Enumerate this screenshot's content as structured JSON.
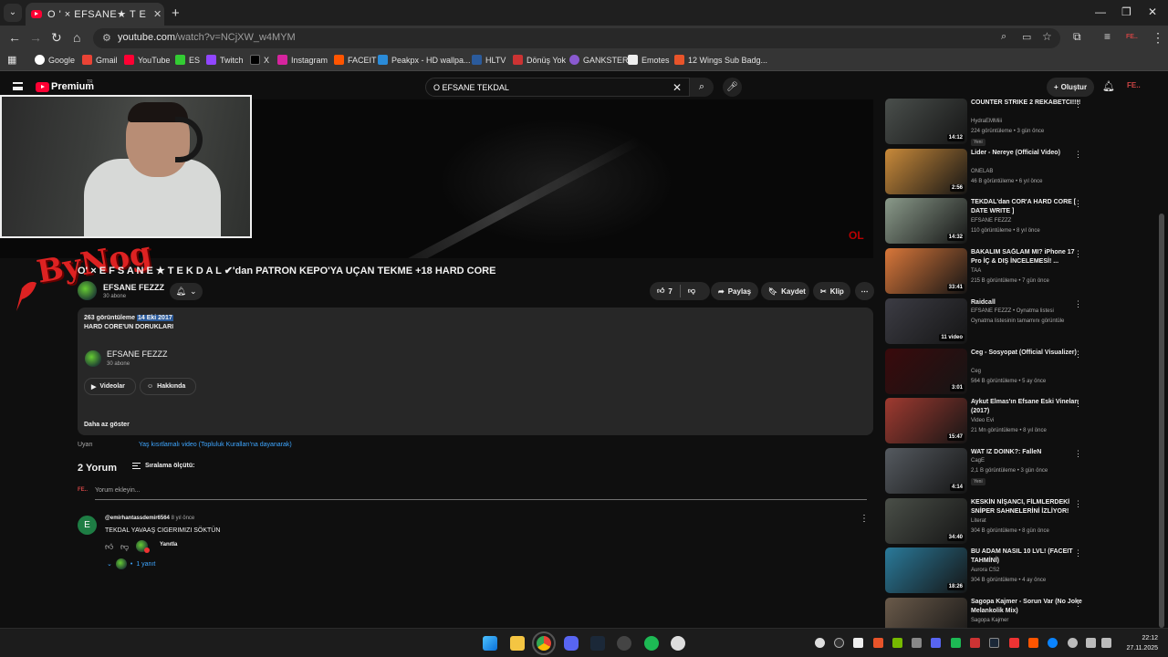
{
  "browser": {
    "tab_title": "O ' × EFSANE★ T E K D A L ...",
    "url_host": "youtube.com",
    "url_path": "/watch?v=NCjXW_w4MYM",
    "bookmarks": [
      "Google",
      "Gmail",
      "YouTube",
      "ES",
      "Twitch",
      "X",
      "Instagram",
      "FACEIT",
      "Peakpx - HD wallpa...",
      "HLTV",
      "Dönüş Yok",
      "GANKSTER",
      "Emotes",
      "12 Wings Sub Badg..."
    ]
  },
  "youtube": {
    "brand": "Premium",
    "country": "TR",
    "search_query": "O EFSANE TEKDAL",
    "create_label": "Oluştur",
    "avatar_label": "FE.."
  },
  "video": {
    "overlay_logo_text": "ByNog",
    "corner_text": "OL",
    "title": "O' × E F S A N E ★ T E K D A L ✔'dan PATRON KEPO'YA UÇAN TEKME +18 HARD CORE",
    "channel_name": "EFSANE FEZZZ",
    "channel_subs": "30 abone",
    "likes": "7",
    "share_label": "Paylaş",
    "save_label": "Kaydet",
    "clip_label": "Klip"
  },
  "description": {
    "views": "263 görüntüleme",
    "date": "14 Eki 2017",
    "text": "HARD CORE'UN DORUKLARI",
    "channel_name": "EFSANE FEZZZ",
    "channel_subs": "30 abone",
    "videos_label": "Videolar",
    "about_label": "Hakkında",
    "less_label": "Daha az göster"
  },
  "warning": {
    "label": "Uyarı",
    "text": "Yaş kısıtlamalı video (Topluluk Kuralları'na dayanarak)"
  },
  "comments": {
    "count": "2 Yorum",
    "sort_label": "Sıralama ölçütü:",
    "me_label": "FE..",
    "add_placeholder": "Yorum ekleyin...",
    "items": [
      {
        "avatar": "E",
        "user": "@emirhantassdemir6564",
        "time": "8 yıl önce",
        "text": "TEKDAL YAVAAŞ CIGERIMIZI SÖKTÜN",
        "reply_label": "Yanıtla",
        "replies": "1 yanıt"
      }
    ]
  },
  "recommendations": [
    {
      "title": "COUNTER STRIKE 2 REKABETCI!!!!",
      "channel": "HydraEMMiii",
      "views": "224 görüntüleme • 3 gün önce",
      "badge": "Yeni",
      "duration": "14:12",
      "thumb": "#4a4f4c"
    },
    {
      "title": "Lider - Nereye (Official Video)",
      "channel": "ONELAB",
      "views": "46 B görüntüleme • 6 yıl önce",
      "badge": "",
      "duration": "2:56",
      "thumb": "#c98a3a"
    },
    {
      "title": "TEKDAL'dan COR'A HARD CORE [ DATE WRITE ]",
      "channel": "EFSANE FEZZZ",
      "views": "110 görüntüleme • 8 yıl önce",
      "badge": "",
      "duration": "14:32",
      "thumb": "#8a9a8a"
    },
    {
      "title": "BAKALIM SAĞLAM MI? iPhone 17 Pro İÇ & DIŞ İNCELEMESİ! ...",
      "channel": "TAA",
      "views": "215 B görüntüleme • 7 gün önce",
      "badge": "",
      "duration": "33:41",
      "thumb": "#d9773a"
    },
    {
      "title": "Raidcall",
      "channel": "EFSANE FEZZZ • Oynatma listesi",
      "views": "Oynatma listesinin tamamını görüntüle",
      "badge": "",
      "duration": "11 video",
      "thumb": "#3c3c44"
    },
    {
      "title": "Ceg - Sosyopat (Official Visualizer)",
      "channel": "Ceg",
      "views": "564 B görüntüleme • 5 ay önce",
      "badge": "",
      "duration": "3:01",
      "thumb": "#3a0a0c"
    },
    {
      "title": "Aykut Elmas'ın Efsane Eski Vineları (2017)",
      "channel": "Video Evi",
      "views": "21 Mn görüntüleme • 8 yıl önce",
      "badge": "",
      "duration": "15:47",
      "thumb": "#a03a30"
    },
    {
      "title": "WAT IZ DOINK?: FalleN",
      "channel": "CagE",
      "views": "2,1 B görüntüleme • 3 gün önce",
      "badge": "Yeni",
      "duration": "4:14",
      "thumb": "#555a60"
    },
    {
      "title": "KESKİN NİŞANCI, FİLMLERDEKİ SNİPER SAHNELERİNİ İZLİYOR!",
      "channel": "Literat",
      "views": "304 B görüntüleme • 8 gün önce",
      "badge": "",
      "duration": "34:40",
      "thumb": "#4a4f48"
    },
    {
      "title": "BU ADAM NASIL 10 LVL! (FACEIT TAHMİNİ)",
      "channel": "Aurora CS2",
      "views": "304 B görüntüleme • 4 ay önce",
      "badge": "",
      "duration": "18:26",
      "thumb": "#2a7a9a"
    },
    {
      "title": "Sagopa Kajmer - Sorun Var (No Joke Melankolik Mix)",
      "channel": "Sagopa Kajmer",
      "views": "",
      "badge": "",
      "duration": "",
      "thumb": "#6a5a4a"
    }
  ],
  "taskbar": {
    "time": "22:12",
    "date": "27.11.2025"
  }
}
